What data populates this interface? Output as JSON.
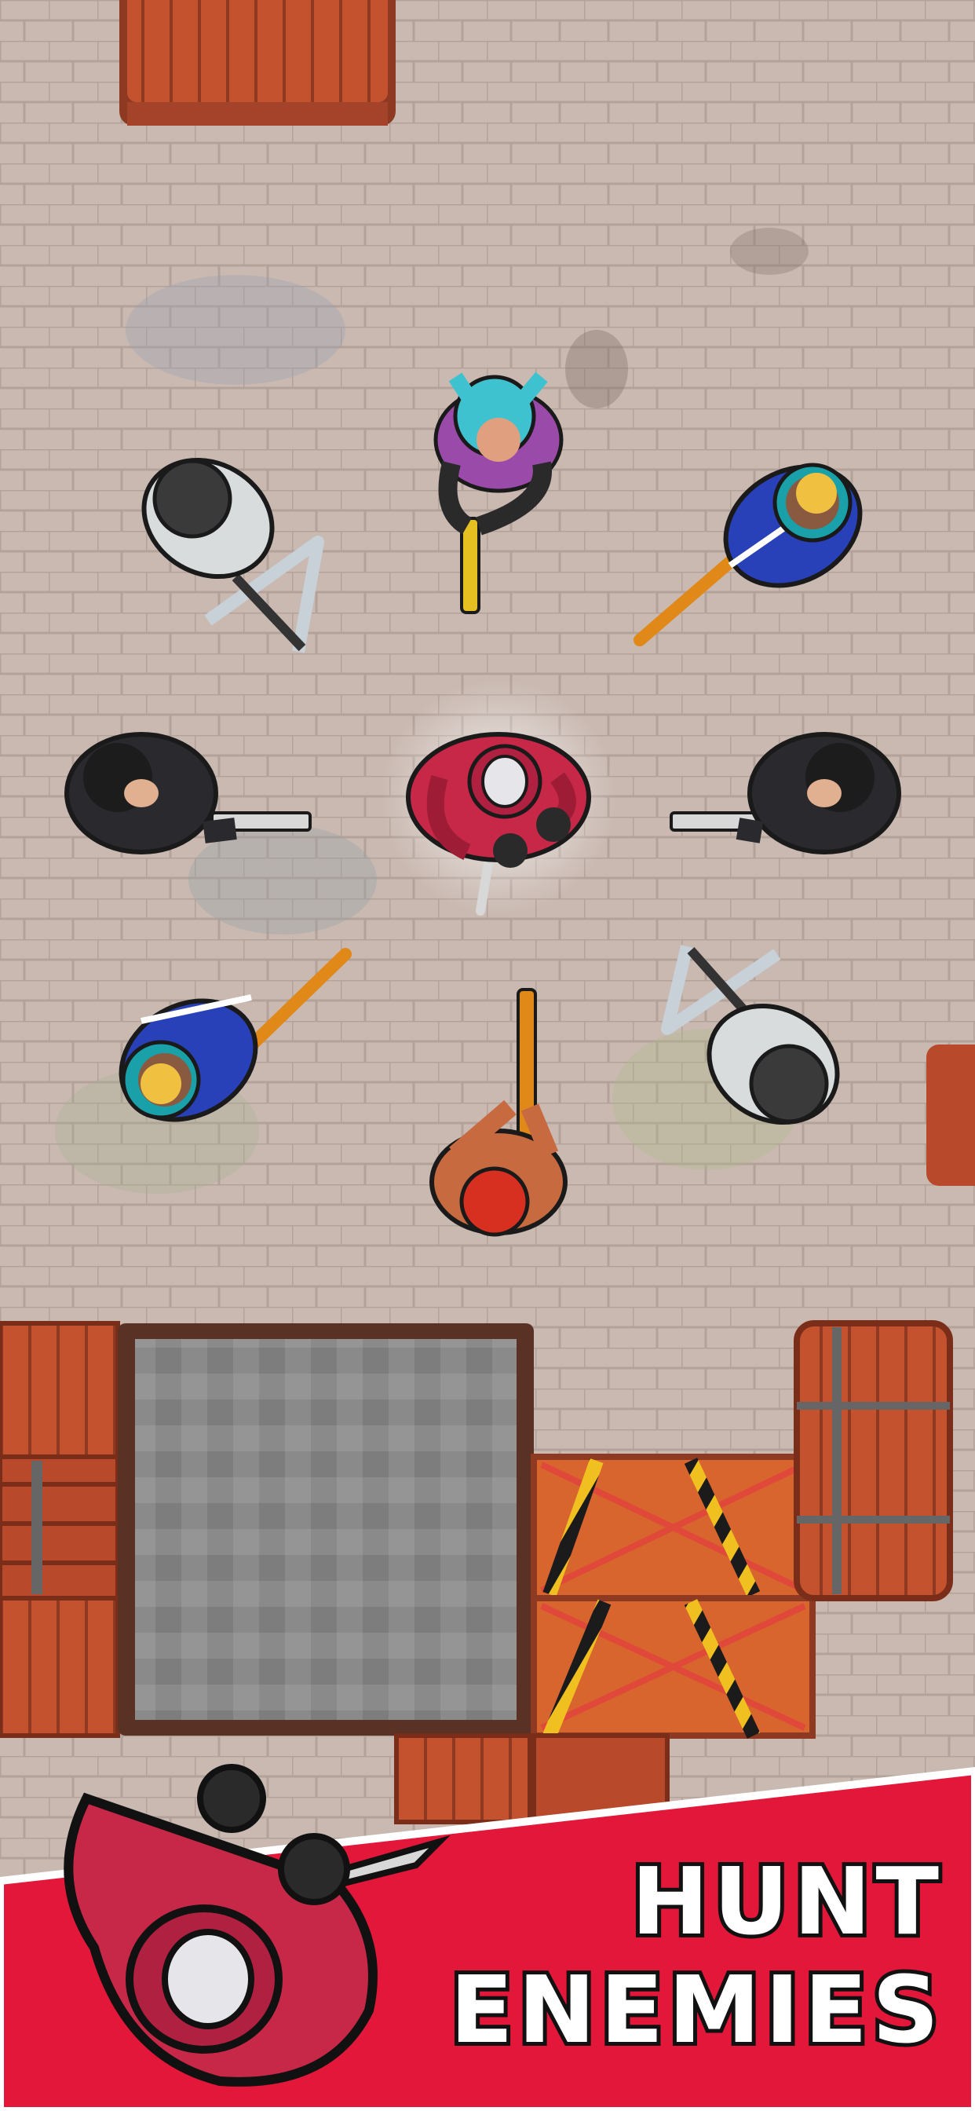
{
  "screen": {
    "name": "promo-screenshot",
    "banner": {
      "line1": "HUNT",
      "line2": "ENEMIES",
      "color": "#e3173a"
    }
  },
  "characters": [
    {
      "name": "player-hooded-assassin",
      "weapon": "knife"
    },
    {
      "name": "enemy-girl-cyan-hair",
      "weapon": "golden-pistol"
    },
    {
      "name": "enemy-tracksuit-top-right",
      "weapon": "rifle"
    },
    {
      "name": "enemy-suit-right",
      "weapon": "pistol"
    },
    {
      "name": "enemy-soldier-bottom-right",
      "weapon": "sniper"
    },
    {
      "name": "enemy-red-helmet-bottom",
      "weapon": "rifle"
    },
    {
      "name": "enemy-tracksuit-bottom-left",
      "weapon": "rifle"
    },
    {
      "name": "enemy-suit-left",
      "weapon": "pistol"
    },
    {
      "name": "enemy-soldier-top-left",
      "weapon": "sniper"
    }
  ],
  "colors": {
    "floor": "#c9b9b1",
    "tile_line": "#b4a39b",
    "crate": "#c0502f",
    "crate_dark": "#8e3a22",
    "hood": "#c82848",
    "suit": "#2a2a2e",
    "tracksuit": "#2840b8"
  }
}
